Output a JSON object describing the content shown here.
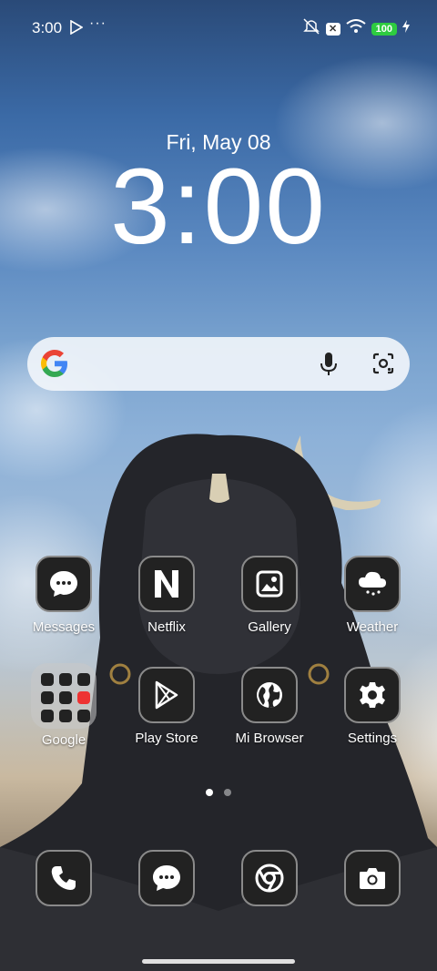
{
  "status_bar": {
    "time": "3:00",
    "more": "···",
    "battery": "100"
  },
  "lockscreen": {
    "date": "Fri, May 08",
    "clock": "3:00"
  },
  "home": {
    "row1": [
      {
        "label": "Messages",
        "icon": "message-bubble-icon"
      },
      {
        "label": "Netflix",
        "icon": "netflix-n-icon"
      },
      {
        "label": "Gallery",
        "icon": "gallery-image-icon"
      },
      {
        "label": "Weather",
        "icon": "weather-cloud-icon"
      }
    ],
    "row2": [
      {
        "label": "Google",
        "icon": "folder-icon"
      },
      {
        "label": "Play Store",
        "icon": "play-store-icon"
      },
      {
        "label": "Mi Browser",
        "icon": "globe-icon"
      },
      {
        "label": "Settings",
        "icon": "gear-icon"
      }
    ]
  },
  "dock": [
    "phone-icon",
    "message-bubble-icon",
    "chrome-icon",
    "camera-icon"
  ],
  "page_indicator": {
    "pages": 2,
    "current": 1
  },
  "colors": {
    "accent_battery": "#2ecc40",
    "icon_tile": "#222222"
  }
}
